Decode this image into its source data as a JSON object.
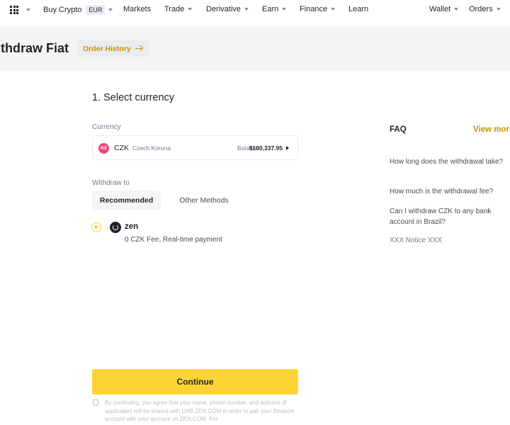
{
  "nav": {
    "items": [
      {
        "label": "Buy Crypto",
        "badge": "EUR"
      },
      {
        "label": "Markets"
      },
      {
        "label": "Trade"
      },
      {
        "label": "Derivative"
      },
      {
        "label": "Earn"
      },
      {
        "label": "Finance"
      },
      {
        "label": "Learn"
      },
      {
        "label": "Wallet"
      },
      {
        "label": "Orders"
      }
    ]
  },
  "header": {
    "title": "ithdraw Fiat",
    "order_history": "Order History"
  },
  "main": {
    "section_title": "1. Select currency",
    "currency_label": "Currency",
    "currency": {
      "icon_text": "Kč",
      "code": "CZK",
      "name": "Czech Koruna",
      "balance_label": "Balance:",
      "balance_value": "$100,337.95"
    },
    "withdraw_to_label": "Withdraw to",
    "tabs": [
      {
        "label": "Recommended",
        "active": true
      },
      {
        "label": "Other Methods",
        "active": false
      }
    ],
    "method": {
      "name": "zen",
      "description": "0 CZK Fee, Real-time payment",
      "selected": true
    },
    "continue_label": "Continue",
    "disclaimer": "By continuing, you agree that your name, phone number, and address (if applicable) will be shared with UAB ZEN.COM in order to pair your Binance account with your account on ZEN.COM. For"
  },
  "faq": {
    "title": "FAQ",
    "view_more": "View mor",
    "items": [
      "How long does the withdrawal take?",
      "How much is the withdrawal fee?",
      "Can I withdraw CZK to any bank account in Brazil?"
    ],
    "notice": "XXX Notice XXX"
  },
  "colors": {
    "accent": "#fcd535",
    "link": "#c99400",
    "currency_icon": "#e8477a"
  }
}
